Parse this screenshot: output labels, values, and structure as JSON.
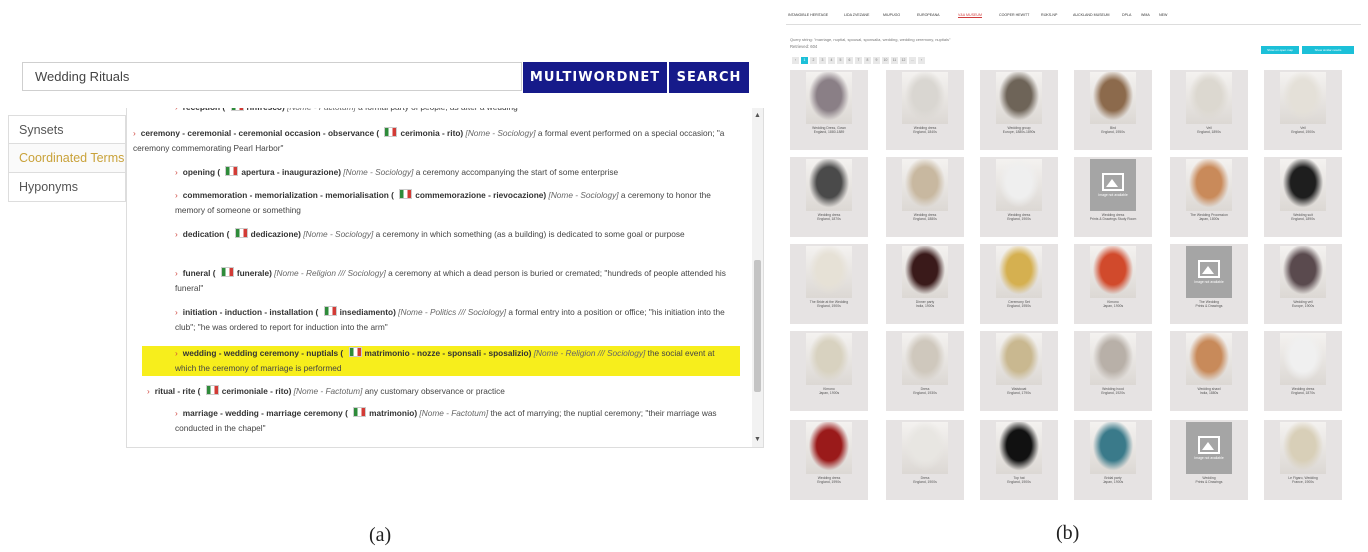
{
  "panel_a": {
    "search_value": "Wedding Rituals",
    "buttons": {
      "multiwordnet": "MULTIWORDNET",
      "search": "SEARCH"
    },
    "tabs": [
      "Synsets",
      "Coordinated Terms",
      "Hyponyms"
    ],
    "active_tab": "Coordinated Terms",
    "entries": [
      {
        "terms": "reception",
        "it": "rinfresco",
        "domain": "Nome - Factotum",
        "gloss": "a formal party of people; as after a wedding"
      },
      {
        "terms": "ceremony - ceremonial - ceremonial occasion - observance",
        "it": "cerimonia - rito",
        "domain": "Nome - Sociology",
        "gloss": "a formal event performed on a special occasion; \"a ceremony commemorating Pearl Harbor\""
      },
      {
        "terms": "opening",
        "it": "apertura - inaugurazione",
        "domain": "Nome - Sociology",
        "gloss": "a ceremony accompanying the start of some enterprise"
      },
      {
        "terms": "commemoration - memorialization - memorialisation",
        "it": "commemorazione - rievocazione",
        "domain": "Nome - Sociology",
        "gloss": "a ceremony to honor the memory of someone or something"
      },
      {
        "terms": "dedication",
        "it": "dedicazione",
        "domain": "Nome - Sociology",
        "gloss": "a ceremony in which something (as a building) is dedicated to some goal or purpose"
      },
      {
        "terms": "funeral",
        "it": "funerale",
        "domain": "Nome - Religion /// Sociology",
        "gloss": "a ceremony at which a dead person is buried or cremated; \"hundreds of people attended his funeral\""
      },
      {
        "terms": "initiation - induction - installation",
        "it": "insediamento",
        "domain": "Nome - Politics /// Sociology",
        "gloss": "a formal entry into a position or office; \"his initiation into the club\"; \"he was ordered to report for induction into the arm\""
      },
      {
        "terms": "wedding - wedding ceremony - nuptials",
        "it": "matrimonio - nozze - sponsali - sposalizio",
        "domain": "Nome - Religion /// Sociology",
        "gloss": "the social event at which the ceremony of marriage is performed"
      },
      {
        "terms": "ritual - rite",
        "it": "cerimoniale - rito",
        "domain": "Nome - Factotum",
        "gloss": "any customary observance or practice"
      },
      {
        "terms": "marriage - wedding - marriage ceremony",
        "it": "matrimonio",
        "domain": "Nome - Factotum",
        "gloss": "the act of marrying; the nuptial ceremony; \"their marriage was conducted in the chapel\""
      }
    ],
    "caption": "(a)"
  },
  "panel_b": {
    "nav": [
      "INTANGIBLE HERITAGE",
      "LIDA ZVEZANE",
      "MIUPUGO",
      "EUROPEANA",
      "V&A MUSEUM",
      "COOPER HEWITT",
      "RIJKS-NP",
      "AUCKLAND MUSEUM",
      "DPLA",
      "WMA",
      "NEW"
    ],
    "nav_current": "V&A MUSEUM",
    "query": "Query string: \"marriage, nuptial, spousal, sponsalia, wedding, wedding ceremony, nuptials\"",
    "retrieved": "Retrieved: 604",
    "pages": [
      "‹",
      "1",
      "2",
      "3",
      "4",
      "5",
      "6",
      "7",
      "8",
      "9",
      "10",
      "11",
      "12",
      "...",
      "›"
    ],
    "current_page": "1",
    "buttons": [
      "Show on open map",
      "Show similar results"
    ],
    "cards": [
      {
        "caption": "Wedding Dress, Gown\nEngland, 1880-1889",
        "tone": "#8a7f86"
      },
      {
        "caption": "Wedding dress\nEngland, 1840s",
        "tone": "#d9d6d1"
      },
      {
        "caption": "Wedding group\nEurope, 1880s-1890s",
        "tone": "#6e6458"
      },
      {
        "caption": "Bird\nEngland, 1950s",
        "tone": "#8c6a4c"
      },
      {
        "caption": "Veil\nEngland, 1890s",
        "tone": "#dcd8d0"
      },
      {
        "caption": "Veil\nEngland, 1900s",
        "tone": "#e4e0d8"
      },
      {
        "caption": "Wedding dress\nEngland, 1870s",
        "tone": "#4a4a4a"
      },
      {
        "caption": "Wedding dress\nEngland, 1880s",
        "tone": "#c8b8a0"
      },
      {
        "caption": "Wedding dress\nEngland, 1900s",
        "tone": "#efefef"
      },
      {
        "caption": "Wedding dress\nPrints & Drawings Study Room",
        "na": true
      },
      {
        "caption": "The Wedding Procession\nJapan, 1800s",
        "tone": "#c98a5a"
      },
      {
        "caption": "Wedding suit\nEngland, 1890s",
        "tone": "#1e1e1e"
      },
      {
        "caption": "The Bride at the Wedding\nEngland, 1900s",
        "tone": "#e6e1d6"
      },
      {
        "caption": "Dinner party\nIndia, 1900s",
        "tone": "#3a1a1a"
      },
      {
        "caption": "Ceremony Set\nEngland, 1950s",
        "tone": "#d5b050"
      },
      {
        "caption": "Kimono\nJapan, 1900s",
        "tone": "#d14a2c"
      },
      {
        "caption": "The Wedding\nPrints & Drawings",
        "na": true
      },
      {
        "caption": "Wedding veil\nEurope, 1900s",
        "tone": "#5a4a4e"
      },
      {
        "caption": "Kimono\nJapan, 1900s",
        "tone": "#d8d2c0"
      },
      {
        "caption": "Dress\nEngland, 1930s",
        "tone": "#cfc8bd"
      },
      {
        "caption": "Waistcoat\nEngland, 1790s",
        "tone": "#c9b890"
      },
      {
        "caption": "Wedding hood\nEngland, 1920s",
        "tone": "#b8b0a8"
      },
      {
        "caption": "Wedding shawl\nIndia, 1880s",
        "tone": "#c88a5a"
      },
      {
        "caption": "Wedding dress\nEngland, 1870s",
        "tone": "#f0f0f0"
      },
      {
        "caption": "Wedding dress\nEngland, 1990s",
        "tone": "#9a1a1a"
      },
      {
        "caption": "Dress\nEngland, 1900s",
        "tone": "#e8e6e2"
      },
      {
        "caption": "Top hat\nEngland, 1900s",
        "tone": "#111111"
      },
      {
        "caption": "Bridal party\nJapan, 1900s",
        "tone": "#3a7a8a"
      },
      {
        "caption": "Wedding\nPrints & Drawings",
        "na": true
      },
      {
        "caption": "Le Figaro, Wedding\nFrance, 1900s",
        "tone": "#d8cfb8"
      }
    ],
    "image_not_available": "Image not available",
    "caption": "(b)"
  }
}
